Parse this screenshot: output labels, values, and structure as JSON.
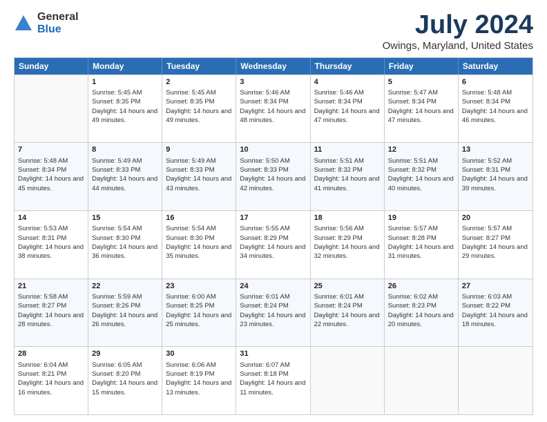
{
  "logo": {
    "general": "General",
    "blue": "Blue"
  },
  "title": "July 2024",
  "subtitle": "Owings, Maryland, United States",
  "days_of_week": [
    "Sunday",
    "Monday",
    "Tuesday",
    "Wednesday",
    "Thursday",
    "Friday",
    "Saturday"
  ],
  "weeks": [
    [
      {
        "day": "",
        "sunrise": "",
        "sunset": "",
        "daylight": ""
      },
      {
        "day": "1",
        "sunrise": "Sunrise: 5:45 AM",
        "sunset": "Sunset: 8:35 PM",
        "daylight": "Daylight: 14 hours and 49 minutes."
      },
      {
        "day": "2",
        "sunrise": "Sunrise: 5:45 AM",
        "sunset": "Sunset: 8:35 PM",
        "daylight": "Daylight: 14 hours and 49 minutes."
      },
      {
        "day": "3",
        "sunrise": "Sunrise: 5:46 AM",
        "sunset": "Sunset: 8:34 PM",
        "daylight": "Daylight: 14 hours and 48 minutes."
      },
      {
        "day": "4",
        "sunrise": "Sunrise: 5:46 AM",
        "sunset": "Sunset: 8:34 PM",
        "daylight": "Daylight: 14 hours and 47 minutes."
      },
      {
        "day": "5",
        "sunrise": "Sunrise: 5:47 AM",
        "sunset": "Sunset: 8:34 PM",
        "daylight": "Daylight: 14 hours and 47 minutes."
      },
      {
        "day": "6",
        "sunrise": "Sunrise: 5:48 AM",
        "sunset": "Sunset: 8:34 PM",
        "daylight": "Daylight: 14 hours and 46 minutes."
      }
    ],
    [
      {
        "day": "7",
        "sunrise": "Sunrise: 5:48 AM",
        "sunset": "Sunset: 8:34 PM",
        "daylight": "Daylight: 14 hours and 45 minutes."
      },
      {
        "day": "8",
        "sunrise": "Sunrise: 5:49 AM",
        "sunset": "Sunset: 8:33 PM",
        "daylight": "Daylight: 14 hours and 44 minutes."
      },
      {
        "day": "9",
        "sunrise": "Sunrise: 5:49 AM",
        "sunset": "Sunset: 8:33 PM",
        "daylight": "Daylight: 14 hours and 43 minutes."
      },
      {
        "day": "10",
        "sunrise": "Sunrise: 5:50 AM",
        "sunset": "Sunset: 8:33 PM",
        "daylight": "Daylight: 14 hours and 42 minutes."
      },
      {
        "day": "11",
        "sunrise": "Sunrise: 5:51 AM",
        "sunset": "Sunset: 8:32 PM",
        "daylight": "Daylight: 14 hours and 41 minutes."
      },
      {
        "day": "12",
        "sunrise": "Sunrise: 5:51 AM",
        "sunset": "Sunset: 8:32 PM",
        "daylight": "Daylight: 14 hours and 40 minutes."
      },
      {
        "day": "13",
        "sunrise": "Sunrise: 5:52 AM",
        "sunset": "Sunset: 8:31 PM",
        "daylight": "Daylight: 14 hours and 39 minutes."
      }
    ],
    [
      {
        "day": "14",
        "sunrise": "Sunrise: 5:53 AM",
        "sunset": "Sunset: 8:31 PM",
        "daylight": "Daylight: 14 hours and 38 minutes."
      },
      {
        "day": "15",
        "sunrise": "Sunrise: 5:54 AM",
        "sunset": "Sunset: 8:30 PM",
        "daylight": "Daylight: 14 hours and 36 minutes."
      },
      {
        "day": "16",
        "sunrise": "Sunrise: 5:54 AM",
        "sunset": "Sunset: 8:30 PM",
        "daylight": "Daylight: 14 hours and 35 minutes."
      },
      {
        "day": "17",
        "sunrise": "Sunrise: 5:55 AM",
        "sunset": "Sunset: 8:29 PM",
        "daylight": "Daylight: 14 hours and 34 minutes."
      },
      {
        "day": "18",
        "sunrise": "Sunrise: 5:56 AM",
        "sunset": "Sunset: 8:29 PM",
        "daylight": "Daylight: 14 hours and 32 minutes."
      },
      {
        "day": "19",
        "sunrise": "Sunrise: 5:57 AM",
        "sunset": "Sunset: 8:28 PM",
        "daylight": "Daylight: 14 hours and 31 minutes."
      },
      {
        "day": "20",
        "sunrise": "Sunrise: 5:57 AM",
        "sunset": "Sunset: 8:27 PM",
        "daylight": "Daylight: 14 hours and 29 minutes."
      }
    ],
    [
      {
        "day": "21",
        "sunrise": "Sunrise: 5:58 AM",
        "sunset": "Sunset: 8:27 PM",
        "daylight": "Daylight: 14 hours and 28 minutes."
      },
      {
        "day": "22",
        "sunrise": "Sunrise: 5:59 AM",
        "sunset": "Sunset: 8:26 PM",
        "daylight": "Daylight: 14 hours and 26 minutes."
      },
      {
        "day": "23",
        "sunrise": "Sunrise: 6:00 AM",
        "sunset": "Sunset: 8:25 PM",
        "daylight": "Daylight: 14 hours and 25 minutes."
      },
      {
        "day": "24",
        "sunrise": "Sunrise: 6:01 AM",
        "sunset": "Sunset: 8:24 PM",
        "daylight": "Daylight: 14 hours and 23 minutes."
      },
      {
        "day": "25",
        "sunrise": "Sunrise: 6:01 AM",
        "sunset": "Sunset: 8:24 PM",
        "daylight": "Daylight: 14 hours and 22 minutes."
      },
      {
        "day": "26",
        "sunrise": "Sunrise: 6:02 AM",
        "sunset": "Sunset: 8:23 PM",
        "daylight": "Daylight: 14 hours and 20 minutes."
      },
      {
        "day": "27",
        "sunrise": "Sunrise: 6:03 AM",
        "sunset": "Sunset: 8:22 PM",
        "daylight": "Daylight: 14 hours and 18 minutes."
      }
    ],
    [
      {
        "day": "28",
        "sunrise": "Sunrise: 6:04 AM",
        "sunset": "Sunset: 8:21 PM",
        "daylight": "Daylight: 14 hours and 16 minutes."
      },
      {
        "day": "29",
        "sunrise": "Sunrise: 6:05 AM",
        "sunset": "Sunset: 8:20 PM",
        "daylight": "Daylight: 14 hours and 15 minutes."
      },
      {
        "day": "30",
        "sunrise": "Sunrise: 6:06 AM",
        "sunset": "Sunset: 8:19 PM",
        "daylight": "Daylight: 14 hours and 13 minutes."
      },
      {
        "day": "31",
        "sunrise": "Sunrise: 6:07 AM",
        "sunset": "Sunset: 8:18 PM",
        "daylight": "Daylight: 14 hours and 11 minutes."
      },
      {
        "day": "",
        "sunrise": "",
        "sunset": "",
        "daylight": ""
      },
      {
        "day": "",
        "sunrise": "",
        "sunset": "",
        "daylight": ""
      },
      {
        "day": "",
        "sunrise": "",
        "sunset": "",
        "daylight": ""
      }
    ]
  ]
}
